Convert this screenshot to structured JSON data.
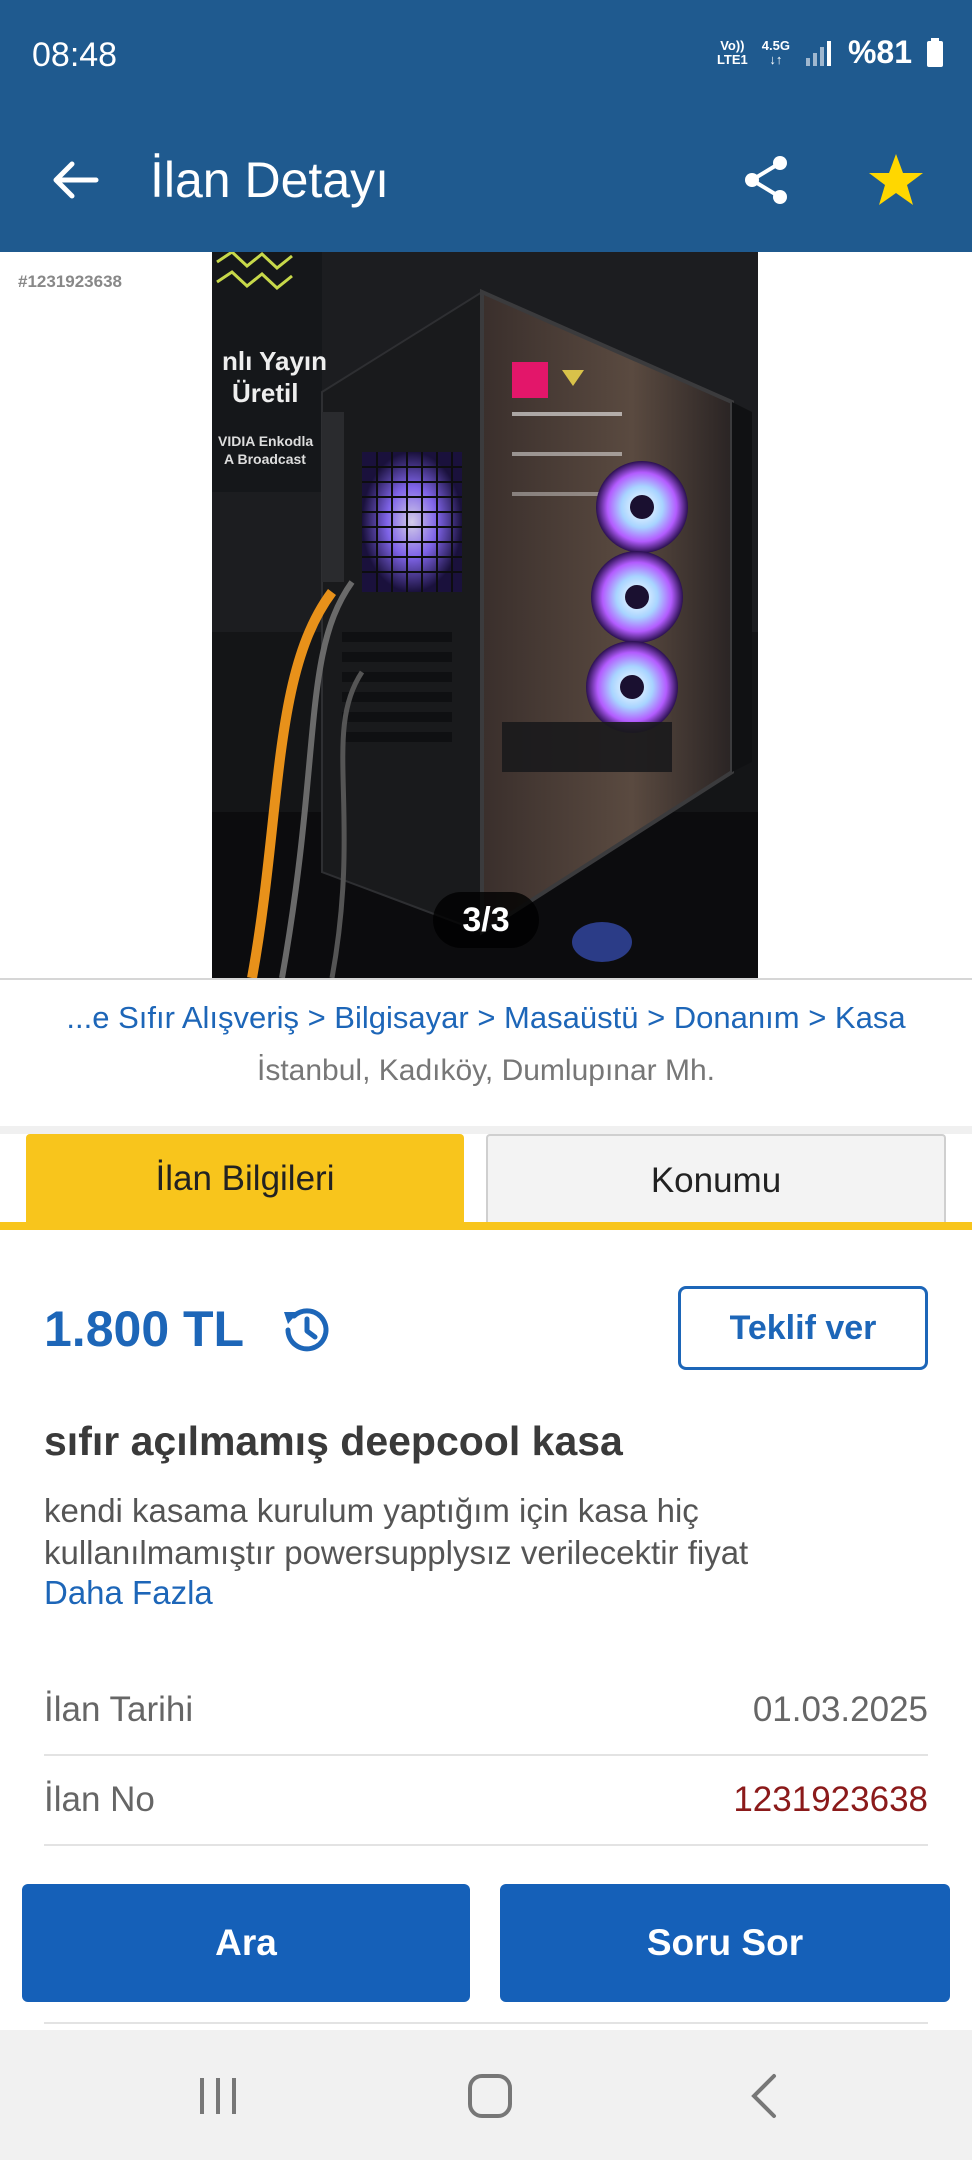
{
  "status_bar": {
    "time": "08:48",
    "network_top": "Vo))",
    "network_bottom": "LTE1",
    "net_type": "4.5G",
    "battery": "%81"
  },
  "app_bar": {
    "title": "İlan Detayı",
    "icons": [
      "back-arrow-icon",
      "share-icon",
      "star-icon"
    ],
    "star_color": "#ffd700"
  },
  "gallery": {
    "ad_id_tag": "#1231923638",
    "counter": "3/3",
    "photo_text": {
      "line1": "nlı Yayın",
      "line2": "Üretil",
      "line3": "VIDIA Enkodla",
      "line4": "A Broadcast"
    }
  },
  "breadcrumb": {
    "items": [
      "...e Sıfır Alışveriş",
      "Bilgisayar",
      "Masaüstü",
      "Donanım",
      "Kasa"
    ],
    "separator": ">"
  },
  "location": "İstanbul, Kadıköy, Dumlupınar Mh.",
  "tabs": {
    "info": "İlan Bilgileri",
    "location": "Konumu"
  },
  "listing": {
    "price": "1.800 TL",
    "offer_button": "Teklif ver",
    "title": "sıfır açılmamış deepcool kasa",
    "description": "kendi kasama kurulum yaptığım için kasa hiç kullanılmamıştır powersupplysız verilecektir fiyat",
    "more_link": "Daha Fazla"
  },
  "details": [
    {
      "label": "İlan Tarihi",
      "value": "01.03.2025"
    },
    {
      "label": "İlan No",
      "value": "1231923638"
    }
  ],
  "actions": {
    "call": "Ara",
    "ask": "Soru Sor"
  },
  "colors": {
    "header": "#1f5a8f",
    "accent_yellow": "#f8c51c",
    "link_blue": "#1d66b8",
    "button_blue": "#1560b8",
    "id_red": "#8b1a1a"
  }
}
